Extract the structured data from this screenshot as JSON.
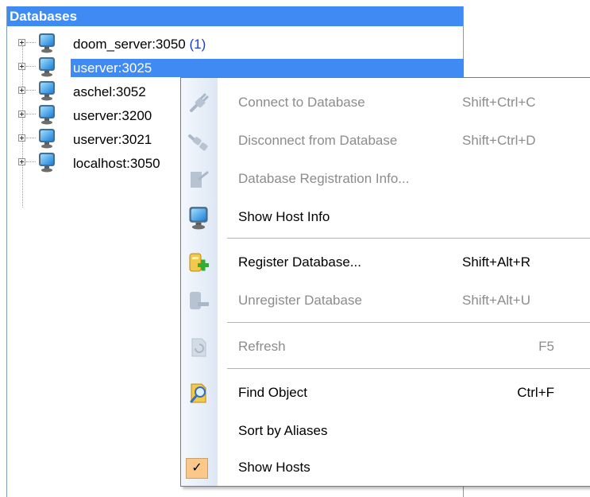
{
  "panel": {
    "title": "Databases"
  },
  "tree": {
    "items": [
      {
        "label": "doom_server:3050",
        "count": "(1)"
      },
      {
        "label": "userver:3025",
        "count": ""
      },
      {
        "label": "aschel:3052",
        "count": ""
      },
      {
        "label": "userver:3200",
        "count": ""
      },
      {
        "label": "userver:3021",
        "count": ""
      },
      {
        "label": "localhost:3050",
        "count": ""
      }
    ]
  },
  "menu": {
    "items": [
      {
        "label": "Connect to Database",
        "shortcut": "Shift+Ctrl+C",
        "enabled": false,
        "icon": "connect-plug-icon"
      },
      {
        "label": "Disconnect from Database",
        "shortcut": "Shift+Ctrl+D",
        "enabled": false,
        "icon": "disconnect-plug-icon"
      },
      {
        "label": "Database Registration Info...",
        "shortcut": "",
        "enabled": false,
        "icon": "registration-info-icon"
      },
      {
        "label": "Show Host Info",
        "shortcut": "",
        "enabled": true,
        "icon": "host-monitor-icon"
      },
      {
        "label": "Register Database...",
        "shortcut": "Shift+Alt+R",
        "enabled": true,
        "icon": "register-database-icon"
      },
      {
        "label": "Unregister Database",
        "shortcut": "Shift+Alt+U",
        "enabled": false,
        "icon": "unregister-database-icon"
      },
      {
        "label": "Refresh",
        "shortcut": "F5",
        "enabled": false,
        "icon": "refresh-icon"
      },
      {
        "label": "Find Object",
        "shortcut": "Ctrl+F",
        "enabled": true,
        "icon": "find-object-icon"
      },
      {
        "label": "Sort by Aliases",
        "shortcut": "",
        "enabled": true,
        "icon": ""
      },
      {
        "label": "Show Hosts",
        "shortcut": "",
        "enabled": true,
        "checked": true,
        "icon": "checkmark-icon"
      }
    ]
  },
  "colors": {
    "selection": "#3f8bf3",
    "header": "#3f8bf3",
    "disabled_text": "#8c8c8c",
    "count_text": "#1a3cd0"
  }
}
